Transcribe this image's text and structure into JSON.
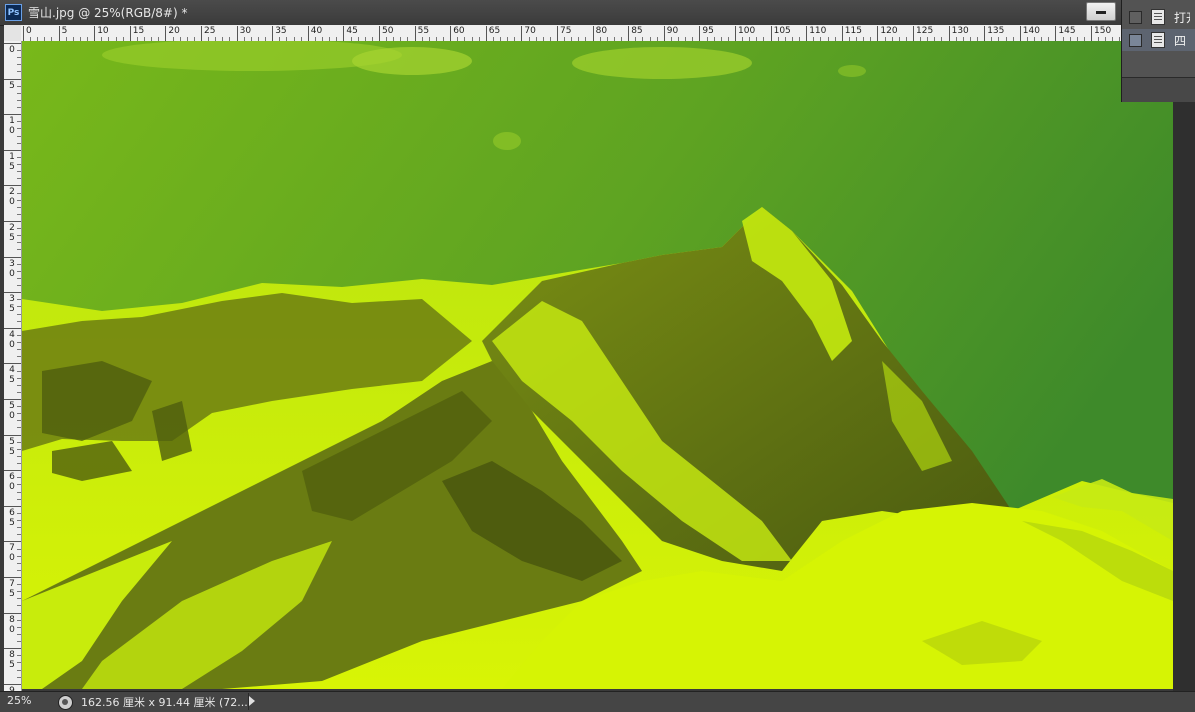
{
  "window": {
    "app_icon": "ps-icon",
    "app_icon_text": "Ps",
    "document_title": "雪山.jpg @ 25%(RGB/8#) *"
  },
  "ruler_top": {
    "labels": [
      "0",
      "5",
      "10",
      "15",
      "20",
      "25",
      "30",
      "35",
      "40",
      "45",
      "50",
      "55",
      "60",
      "65",
      "70",
      "75",
      "80",
      "85",
      "90",
      "95",
      "100",
      "105",
      "110",
      "115",
      "120",
      "125",
      "130",
      "135",
      "140",
      "145",
      "150"
    ]
  },
  "ruler_left": {
    "labels": [
      "0",
      "5",
      "10",
      "15",
      "20",
      "25",
      "30",
      "35",
      "40",
      "45",
      "50",
      "55",
      "60",
      "65",
      "70",
      "75",
      "80",
      "85",
      "9"
    ]
  },
  "canvas": {
    "image_subject": "snow mountain photo with yellow-green tint",
    "colors": {
      "sky_top": "#6fb11e",
      "sky_right": "#3f8d2a",
      "snow": "#d4f20a",
      "rock": "#5b6a12"
    }
  },
  "panel": {
    "items": [
      {
        "label": "打开"
      },
      {
        "label": "四"
      }
    ]
  },
  "statusbar": {
    "zoom": "25%",
    "doc_size": "162.56 厘米 x 91.44 厘米 (72..."
  }
}
